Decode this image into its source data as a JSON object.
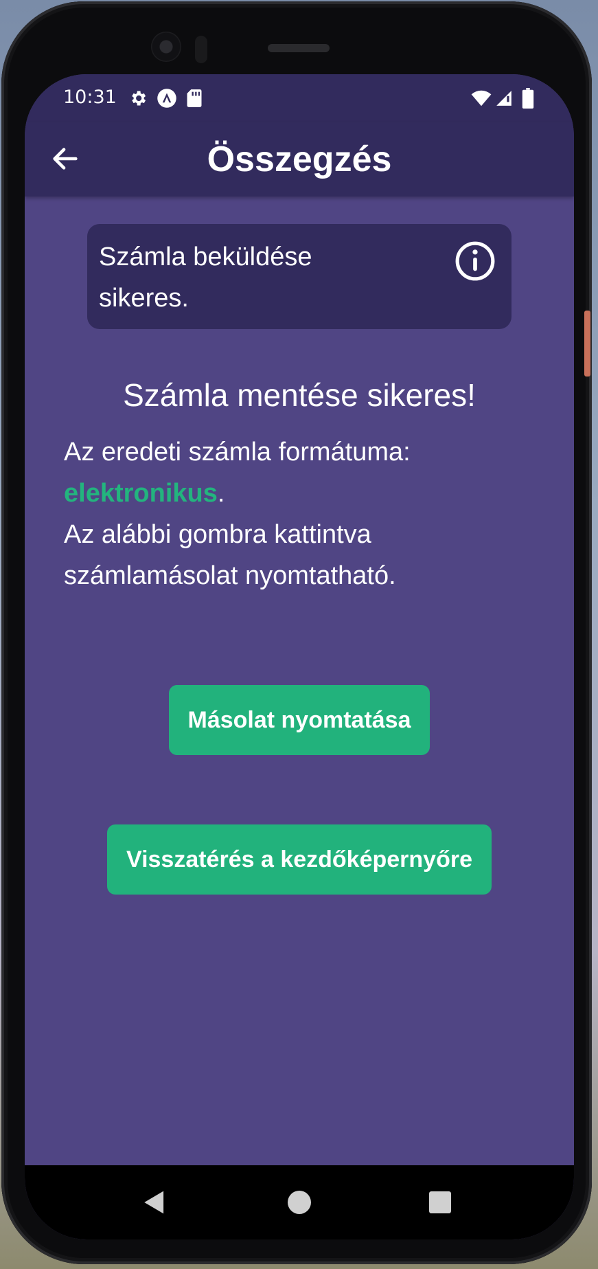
{
  "status_bar": {
    "time": "10:31",
    "icons": [
      "gear-icon",
      "app-icon",
      "sd-card-icon",
      "wifi-icon",
      "signal-icon",
      "battery-icon"
    ]
  },
  "app_bar": {
    "title": "Összegzés",
    "back_icon": "arrow-left-icon"
  },
  "notice": {
    "text": "Számla beküldése sikeres.",
    "icon": "info-icon"
  },
  "main": {
    "heading": "Számla mentése sikeres!",
    "format_label": "Az eredeti számla formátuma: ",
    "format_value": "elektronikus",
    "format_suffix": ".",
    "instruction": "Az alábbi gombra kattintva számlamásolat nyomtatható."
  },
  "buttons": {
    "print_copy": "Másolat nyomtatása",
    "back_home": "Visszatérés a kezdőképernyőre"
  },
  "nav": {
    "back": "back-triangle-icon",
    "home": "home-circle-icon",
    "recents": "recents-square-icon"
  },
  "colors": {
    "primary_dark": "#322b5d",
    "background": "#504584",
    "accent_green": "#22b27c"
  }
}
